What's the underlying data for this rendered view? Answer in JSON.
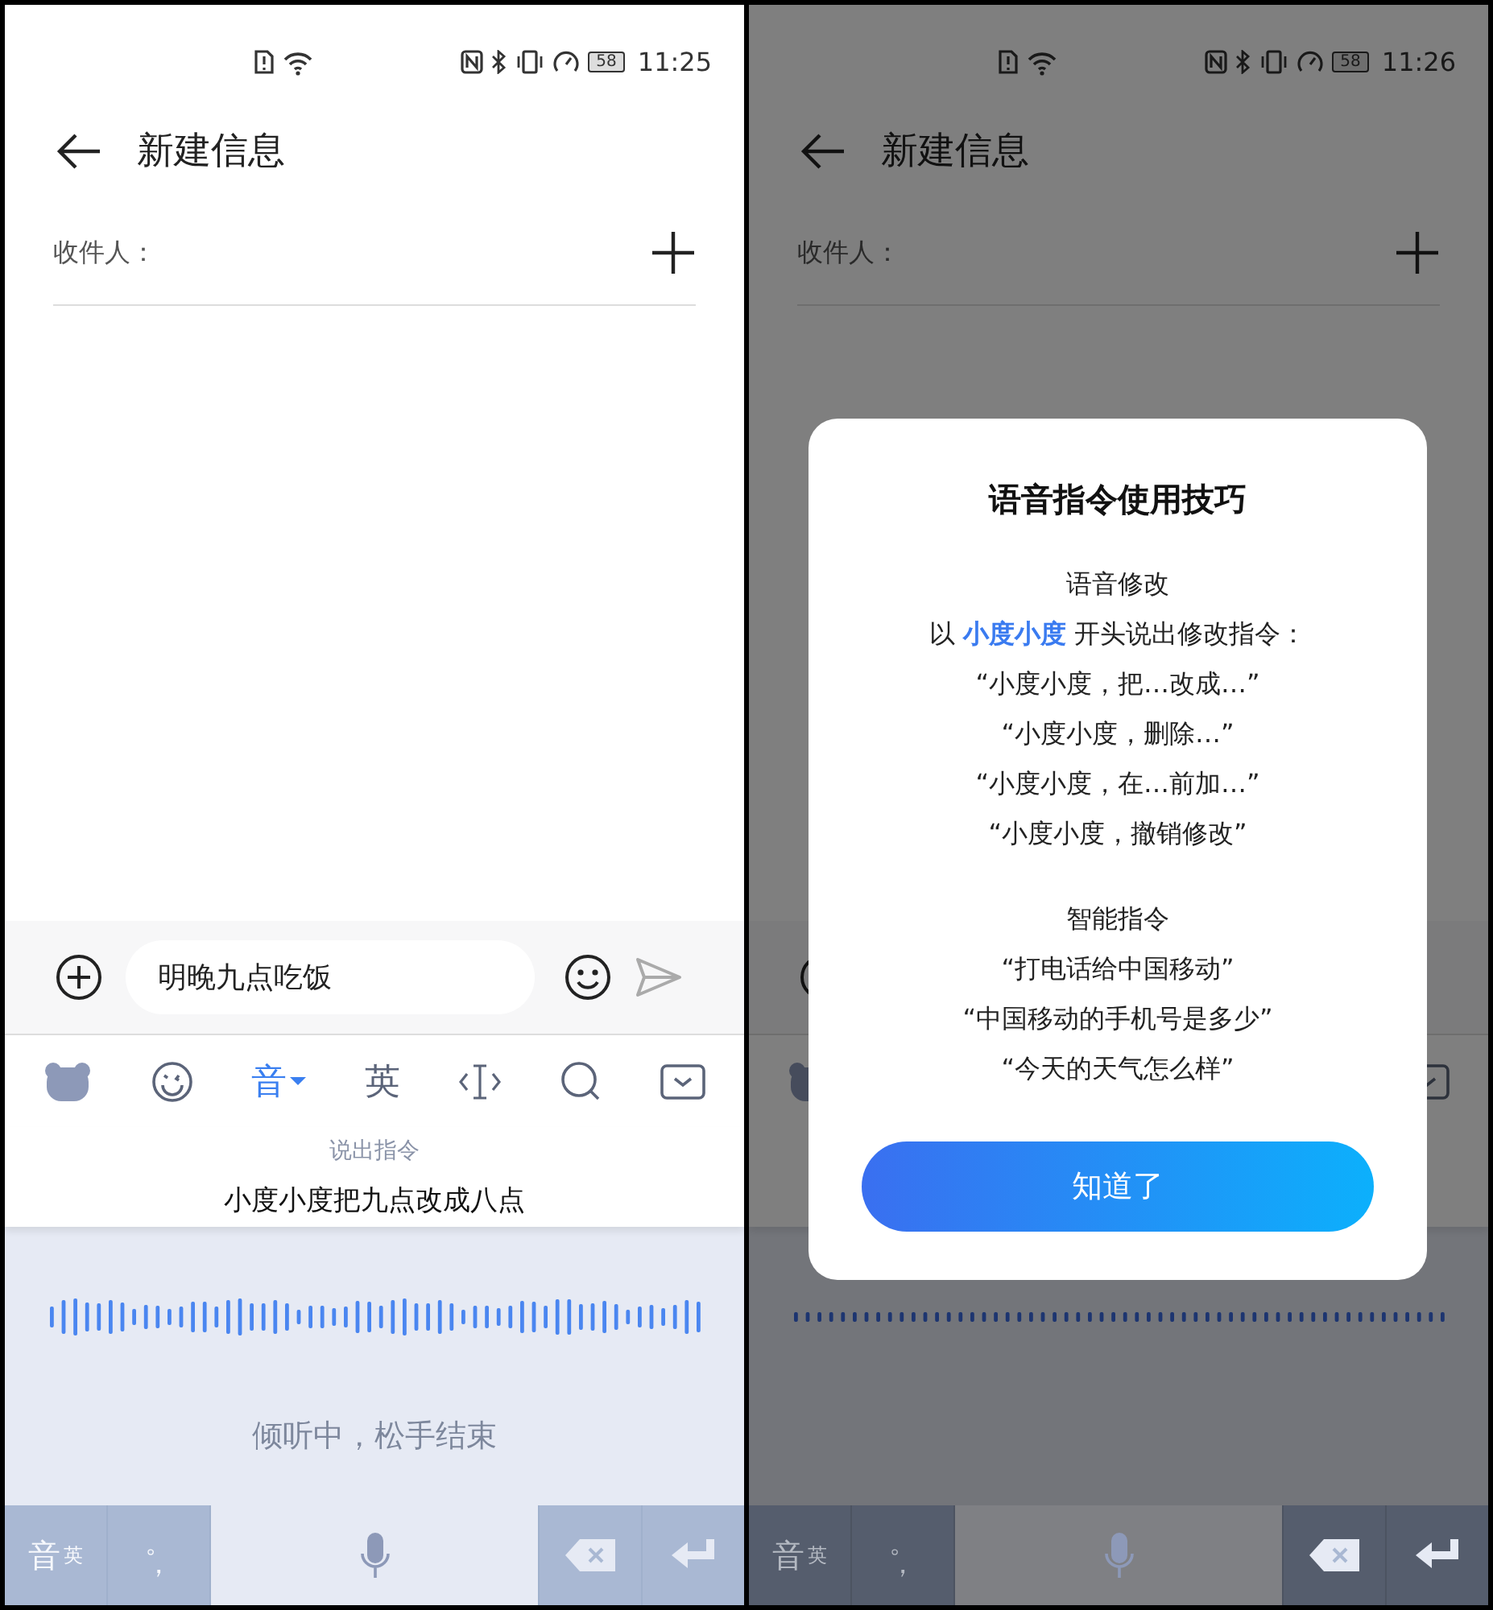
{
  "screens": [
    {
      "status": {
        "time": "11:25",
        "battery": "58"
      },
      "header": {
        "title": "新建信息"
      },
      "recipient": {
        "label": "收件人："
      },
      "compose": {
        "value": "明晚九点吃饭"
      },
      "toolbar": [
        {
          "kind": "logo"
        },
        {
          "kind": "emoji"
        },
        {
          "kind": "text",
          "label": "音",
          "selected": true
        },
        {
          "kind": "text",
          "label": "英",
          "selected": false
        },
        {
          "kind": "cursor"
        },
        {
          "kind": "search"
        },
        {
          "kind": "collapse"
        }
      ],
      "voice": {
        "prompt": "说出指令",
        "transcript": "小度小度把九点改成八点",
        "listening": true,
        "hint": "倾听中，松手结束"
      },
      "keys": {
        "mode": "音",
        "mode_alt": "英",
        "punct_top": "。",
        "punct_bottom": "，"
      }
    },
    {
      "status": {
        "time": "11:26",
        "battery": "58"
      },
      "header": {
        "title": "新建信息"
      },
      "recipient": {
        "label": "收件人："
      },
      "toolbar": [
        {
          "kind": "logo"
        },
        {
          "kind": "collapse"
        }
      ],
      "voice": {
        "listening": false
      },
      "keys": {
        "mode": "音",
        "mode_alt": "英",
        "punct_top": "。",
        "punct_bottom": "，"
      },
      "dialog": {
        "title": "语音指令使用技巧",
        "sections": [
          {
            "heading": "语音修改",
            "lines": [
              "以 **小度小度** 开头说出修改指令：",
              "“小度小度，把…改成…”",
              "“小度小度，删除…”",
              "“小度小度，在…前加…”",
              "“小度小度，撤销修改”"
            ]
          },
          {
            "heading": "智能指令",
            "lines": [
              "“打电话给中国移动”",
              "“中国移动的手机号是多少”",
              "“今天的天气怎么样”"
            ]
          }
        ],
        "button": "知道了"
      }
    }
  ]
}
